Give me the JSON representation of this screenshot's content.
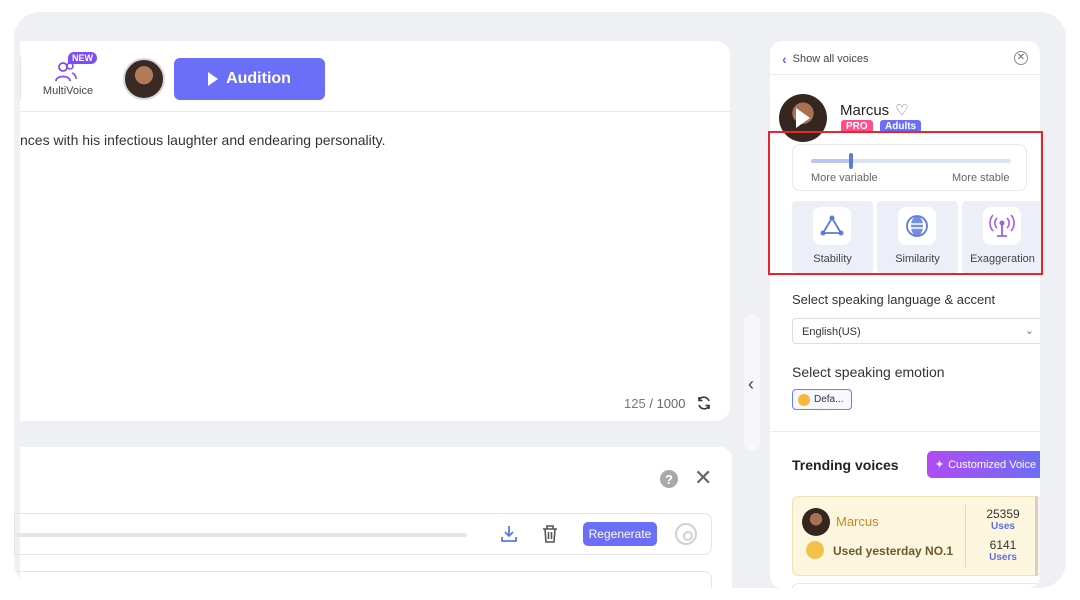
{
  "toolbar": {
    "multivoice_badge": "NEW",
    "multivoice_label": "MultiVoice",
    "audition_label": "Audition"
  },
  "editor": {
    "text": "nces with his infectious laughter and endearing personality.",
    "char_count": "125",
    "char_separator": "/",
    "char_limit": "1000"
  },
  "result": {
    "help_icon": "?",
    "close_icon": "✕",
    "regenerate_label": "Regenerate"
  },
  "voice_panel": {
    "back_label": "Show all voices",
    "close_icon": "✕",
    "voice_name": "Marcus",
    "tags": [
      "PRO",
      "Adults"
    ],
    "slider": {
      "left_label": "More variable",
      "right_label": "More stable",
      "value": 0.2
    },
    "params": [
      {
        "label": "Stability",
        "icon": "triangle-nodes-icon"
      },
      {
        "label": "Similarity",
        "icon": "similarity-icon"
      },
      {
        "label": "Exaggeration",
        "icon": "broadcast-icon"
      }
    ],
    "lang_title": "Select speaking language & accent",
    "lang_value": "English(US)",
    "emotion_title": "Select speaking emotion",
    "emotion_value": "Defa...",
    "trending_title": "Trending voices",
    "custom_voice_label": "Customized Voice",
    "trending": [
      {
        "name": "Marcus",
        "rank_text": "Used yesterday NO.1",
        "uses": "25359",
        "uses_label": "Uses",
        "users": "6141",
        "users_label": "Users"
      }
    ]
  },
  "colors": {
    "accent": "#6b6ef6",
    "highlight_border": "#e8242c",
    "pro_tag": "#ff4d8d",
    "trending_card": "#fdf6de"
  }
}
